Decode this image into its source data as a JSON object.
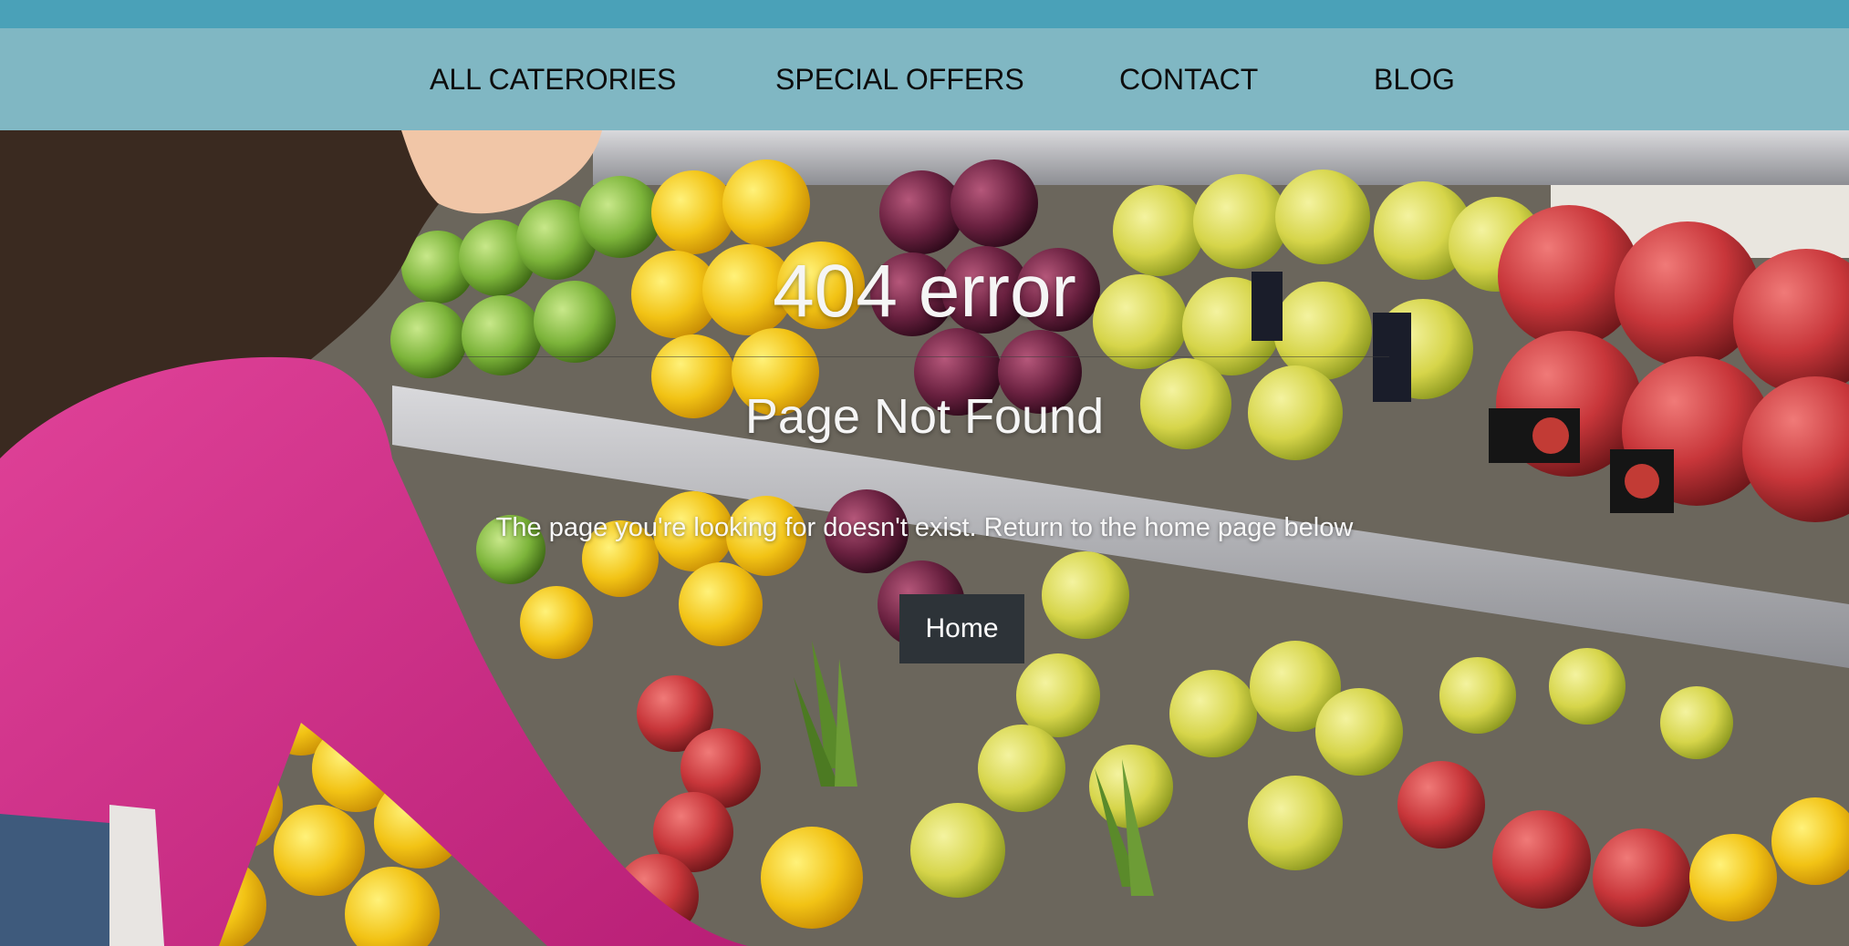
{
  "nav": {
    "items": [
      {
        "label": "ALL CATERORIES"
      },
      {
        "label": "SPECIAL OFFERS"
      },
      {
        "label": "CONTACT"
      },
      {
        "label": "BLOG"
      }
    ]
  },
  "hero": {
    "image": "grocery-produce-shelf-photo",
    "title": "404 error",
    "subtitle": "Page Not Found",
    "message": "The page you're looking for doesn't exist. Return to the home page below",
    "home_button": "Home"
  },
  "colors": {
    "top_strip": "#4aa1b8",
    "navbar": "#80b7c3",
    "button_bg": "#2d3338",
    "text_light": "#f5f5f5"
  }
}
